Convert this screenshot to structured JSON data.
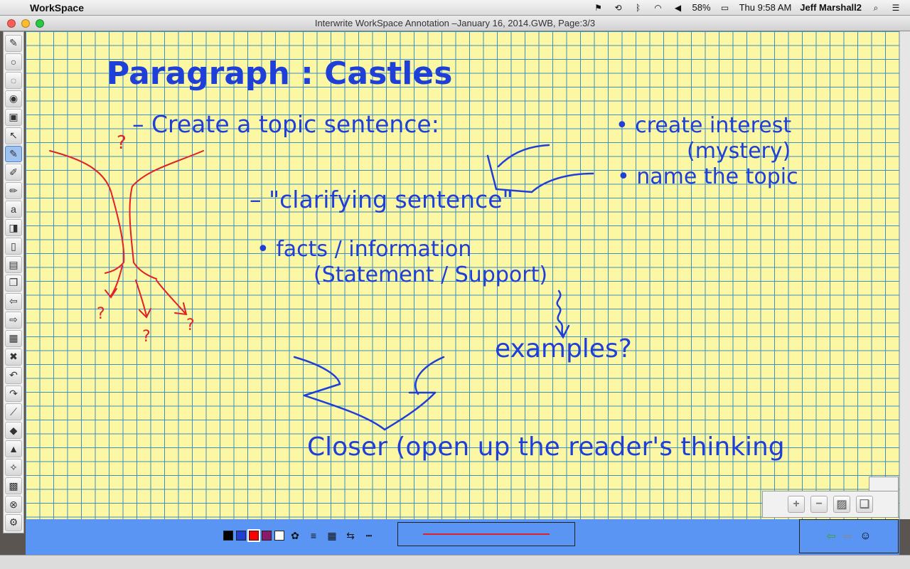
{
  "menubar": {
    "app_name": "WorkSpace",
    "battery": "58%",
    "clock": "Thu 9:58 AM",
    "user": "Jeff Marshall2"
  },
  "window": {
    "title": "Interwrite WorkSpace Annotation –January 16, 2014.GWB, Page:3/3"
  },
  "annotation": {
    "heading": "Paragraph : Castles",
    "line1": "– Create a topic sentence:",
    "bullet1": "• create interest",
    "bullet1_sub": "(mystery)",
    "bullet2": "• name the topic",
    "line2": "– \"clarifying sentence\"",
    "bullet3": "• facts / information",
    "bullet3_sub": "(Statement / Support)",
    "examples": "examples?",
    "closer": "Closer (open up the reader's thinking",
    "qmark": "?"
  },
  "palette": {
    "colors": [
      "#000000",
      "#1f3fd9",
      "#ff0000",
      "#8b1a6b",
      "#ffffff"
    ],
    "current_stroke_color": "#e0202a"
  },
  "colors": {
    "paper": "#fbf7a2",
    "grid": "#3f8ec7",
    "blue_ink": "#1f3fd9",
    "red_ink": "#e0202a",
    "bottom_bar": "#5b95f4"
  },
  "icons": {
    "zoom_in": "+",
    "zoom_out": "−"
  }
}
